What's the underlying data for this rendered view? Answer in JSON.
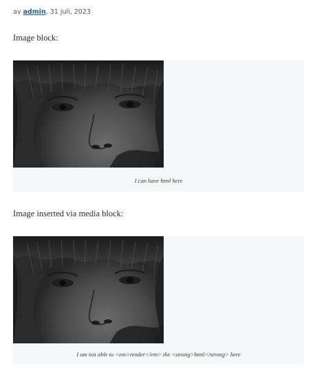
{
  "post_meta": {
    "prefix": "av",
    "author": "admin",
    "date": ", 31 juli, 2023"
  },
  "sections": [
    {
      "heading": "Image block:",
      "caption": "I can have html here"
    },
    {
      "heading": "Image inserted via media block:",
      "caption": "I am not able to <em>render</em> the <strong>html</strong> here"
    }
  ],
  "colors": {
    "link": "#1d5fa6",
    "block_background": "#f6f7f9",
    "text": "#2b2b2b"
  }
}
